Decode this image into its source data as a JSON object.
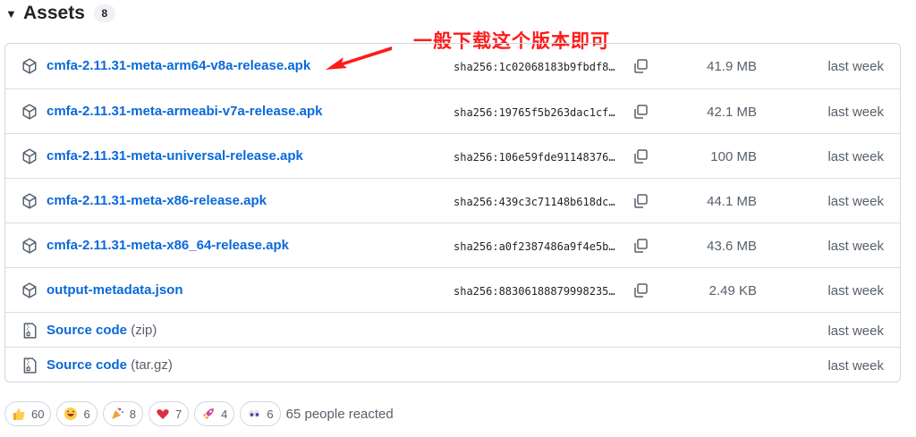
{
  "header": {
    "title": "Assets",
    "count": "8"
  },
  "annotation": {
    "text": "一般下载这个版本即可"
  },
  "assets": [
    {
      "name": "cmfa-2.11.31-meta-arm64-v8a-release.apk",
      "sha": "sha256:1c02068183b9fbdf8…",
      "size": "41.9 MB",
      "time": "last week",
      "icon": "package-icon"
    },
    {
      "name": "cmfa-2.11.31-meta-armeabi-v7a-release.apk",
      "sha": "sha256:19765f5b263dac1cf…",
      "size": "42.1 MB",
      "time": "last week",
      "icon": "package-icon"
    },
    {
      "name": "cmfa-2.11.31-meta-universal-release.apk",
      "sha": "sha256:106e59fde91148376…",
      "size": "100 MB",
      "time": "last week",
      "icon": "package-icon"
    },
    {
      "name": "cmfa-2.11.31-meta-x86-release.apk",
      "sha": "sha256:439c3c71148b618dc…",
      "size": "44.1 MB",
      "time": "last week",
      "icon": "package-icon"
    },
    {
      "name": "cmfa-2.11.31-meta-x86_64-release.apk",
      "sha": "sha256:a0f2387486a9f4e5b…",
      "size": "43.6 MB",
      "time": "last week",
      "icon": "package-icon"
    },
    {
      "name": "output-metadata.json",
      "sha": "sha256:88306188879998235…",
      "size": "2.49 KB",
      "time": "last week",
      "icon": "package-icon"
    }
  ],
  "source": [
    {
      "label": "Source code",
      "format": "(zip)",
      "time": "last week",
      "icon": "file-zip-icon"
    },
    {
      "label": "Source code",
      "format": "(tar.gz)",
      "time": "last week",
      "icon": "file-zip-icon"
    }
  ],
  "reactions": [
    {
      "emoji": "thumbs-up",
      "count": "60"
    },
    {
      "emoji": "laugh",
      "count": "6"
    },
    {
      "emoji": "hooray",
      "count": "8"
    },
    {
      "emoji": "heart",
      "count": "7"
    },
    {
      "emoji": "rocket",
      "count": "4"
    },
    {
      "emoji": "eyes",
      "count": "6"
    }
  ],
  "reactions_summary": "65 people reacted",
  "colors": {
    "link": "#0969da",
    "annotation": "#ff1a1a",
    "border": "#d0d7de"
  }
}
